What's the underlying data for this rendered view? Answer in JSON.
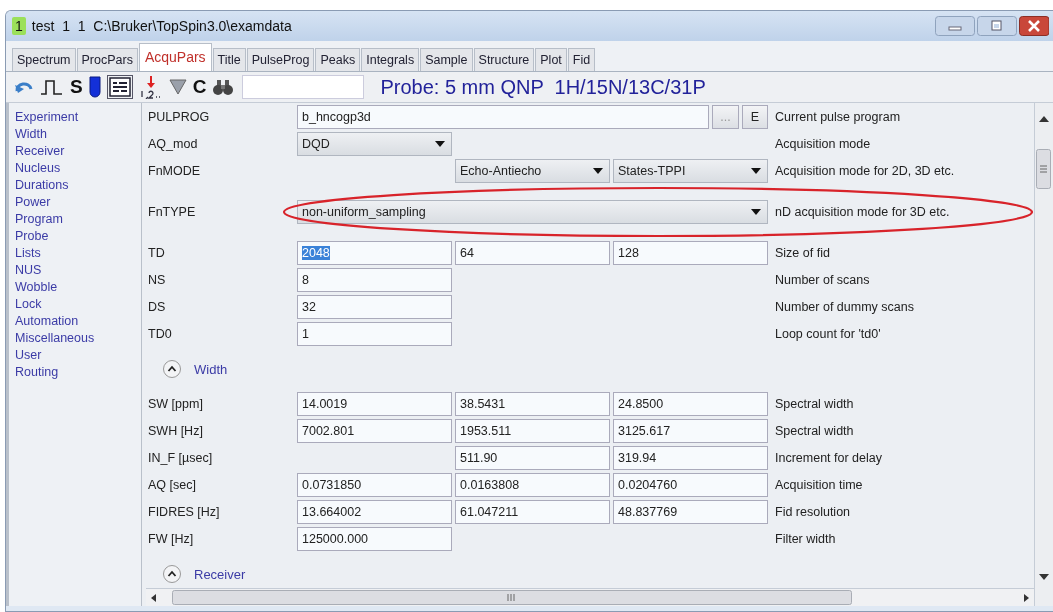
{
  "window": {
    "badge": "1",
    "title": "test  1  1  C:\\Bruker\\TopSpin3.0\\examdata"
  },
  "tabs": [
    {
      "label": "Spectrum",
      "selected": false
    },
    {
      "label": "ProcPars",
      "selected": false
    },
    {
      "label": "AcquPars",
      "selected": true
    },
    {
      "label": "Title",
      "selected": false
    },
    {
      "label": "PulseProg",
      "selected": false
    },
    {
      "label": "Peaks",
      "selected": false
    },
    {
      "label": "Integrals",
      "selected": false
    },
    {
      "label": "Sample",
      "selected": false
    },
    {
      "label": "Structure",
      "selected": false
    },
    {
      "label": "Plot",
      "selected": false
    },
    {
      "label": "Fid",
      "selected": false
    }
  ],
  "toolbar": {
    "letters": [
      "S",
      "C"
    ],
    "probe": "Probe: 5 mm QNP  1H/15N/13C/31P"
  },
  "sidebar": {
    "items": [
      "Experiment",
      "Width",
      "Receiver",
      "Nucleus",
      "Durations",
      "Power",
      "Program",
      "Probe",
      "Lists",
      "NUS",
      "Wobble",
      "Lock",
      "Automation",
      "Miscellaneous",
      "User",
      "Routing"
    ]
  },
  "sections": [
    {
      "rows": [
        {
          "label": "PULPROG",
          "cells": [
            {
              "kind": "input-wide",
              "value": "b_hncogp3d",
              "selected": false
            }
          ],
          "buttons": [
            "...",
            "E"
          ],
          "description": "Current pulse program"
        },
        {
          "label": "AQ_mod",
          "cells": [
            {
              "kind": "select",
              "value": "DQD"
            }
          ],
          "description": "Acquisition mode"
        },
        {
          "label": "FnMODE",
          "cells": [
            {
              "kind": "blank"
            },
            {
              "kind": "select",
              "value": "Echo-Antiecho"
            },
            {
              "kind": "select",
              "value": "States-TPPI"
            }
          ],
          "description": "Acquisition mode for 2D, 3D etc."
        },
        {
          "label": "FnTYPE",
          "circled": true,
          "cells": [
            {
              "kind": "select-wide",
              "value": "non-uniform_sampling"
            }
          ],
          "description": "nD acquisition mode for 3D etc."
        },
        {
          "label": "TD",
          "cells": [
            {
              "kind": "input",
              "value": "2048",
              "selected": true
            },
            {
              "kind": "input",
              "value": "64",
              "selected": false
            },
            {
              "kind": "input",
              "value": "128",
              "selected": false
            }
          ],
          "description": "Size of fid"
        },
        {
          "label": "NS",
          "cells": [
            {
              "kind": "input",
              "value": "8",
              "selected": false
            }
          ],
          "description": "Number of scans"
        },
        {
          "label": "DS",
          "cells": [
            {
              "kind": "input",
              "value": "32",
              "selected": false
            }
          ],
          "description": "Number of dummy scans"
        },
        {
          "label": "TD0",
          "cells": [
            {
              "kind": "input",
              "value": "1",
              "selected": false
            }
          ],
          "description": "Loop count for 'td0'"
        }
      ]
    },
    {
      "title": "Width",
      "expanded": true,
      "rows": [
        {
          "label": "SW [ppm]",
          "cells": [
            {
              "kind": "input",
              "value": "14.0019",
              "selected": false
            },
            {
              "kind": "input",
              "value": "38.5431",
              "selected": false
            },
            {
              "kind": "input",
              "value": "24.8500",
              "selected": false
            }
          ],
          "description": "Spectral width"
        },
        {
          "label": "SWH [Hz]",
          "cells": [
            {
              "kind": "input",
              "value": "7002.801",
              "selected": false
            },
            {
              "kind": "input",
              "value": "1953.511",
              "selected": false
            },
            {
              "kind": "input",
              "value": "3125.617",
              "selected": false
            }
          ],
          "description": "Spectral width"
        },
        {
          "label": "IN_F [µsec]",
          "cells": [
            {
              "kind": "blank"
            },
            {
              "kind": "input",
              "value": "511.90",
              "selected": false
            },
            {
              "kind": "input",
              "value": "319.94",
              "selected": false
            }
          ],
          "description": "Increment for delay"
        },
        {
          "label": "AQ [sec]",
          "cells": [
            {
              "kind": "input",
              "value": "0.0731850",
              "selected": false
            },
            {
              "kind": "input",
              "value": "0.0163808",
              "selected": false
            },
            {
              "kind": "input",
              "value": "0.0204760",
              "selected": false
            }
          ],
          "description": "Acquisition time"
        },
        {
          "label": "FIDRES [Hz]",
          "cells": [
            {
              "kind": "input",
              "value": "13.664002",
              "selected": false
            },
            {
              "kind": "input",
              "value": "61.047211",
              "selected": false
            },
            {
              "kind": "input",
              "value": "48.837769",
              "selected": false
            }
          ],
          "description": "Fid resolution"
        },
        {
          "label": "FW [Hz]",
          "cells": [
            {
              "kind": "input",
              "value": "125000.000",
              "selected": false
            }
          ],
          "description": "Filter width"
        }
      ]
    },
    {
      "title": "Receiver",
      "expanded": true
    }
  ]
}
